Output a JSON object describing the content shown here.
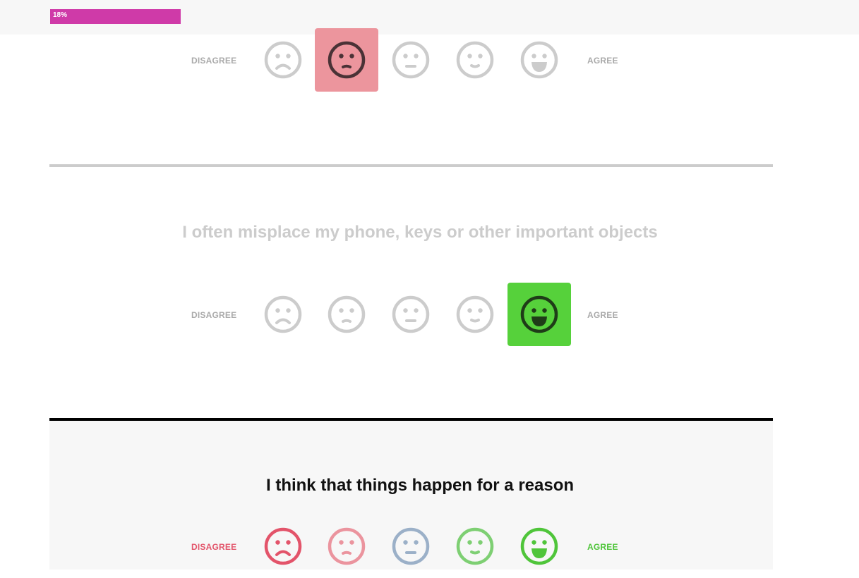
{
  "progress": {
    "label": "18%",
    "fraction": 0.18,
    "color": "#cf3aa8"
  },
  "scale": {
    "disagree_label": "DISAGREE",
    "agree_label": "AGREE"
  },
  "questions": [
    {
      "title": "",
      "state": "answered",
      "selected_index": 1,
      "selected_color": "#ec959d"
    },
    {
      "title": "I often misplace my phone, keys or other important objects",
      "state": "answered",
      "selected_index": 4,
      "selected_color": "#56d13b"
    },
    {
      "title": "I think that things happen for a reason",
      "state": "active",
      "selected_index": null
    }
  ],
  "options": [
    {
      "name": "strongly-disagree-face-icon",
      "active_color": "#e3546a"
    },
    {
      "name": "disagree-face-icon",
      "active_color": "#eb949e"
    },
    {
      "name": "neutral-face-icon",
      "active_color": "#9bb0c8"
    },
    {
      "name": "agree-face-icon",
      "active_color": "#7ecf73"
    },
    {
      "name": "strongly-agree-face-icon",
      "active_color": "#4fc53a"
    }
  ],
  "colors": {
    "inactive_face": "#cccccc",
    "inactive_label": "#aaaaaa",
    "inactive_title": "#cccccc",
    "active_title": "#111111",
    "disagree_active": "#e3546a",
    "agree_active": "#4fc53a",
    "divider_inactive": "#cccccc",
    "divider_active": "#000000"
  }
}
